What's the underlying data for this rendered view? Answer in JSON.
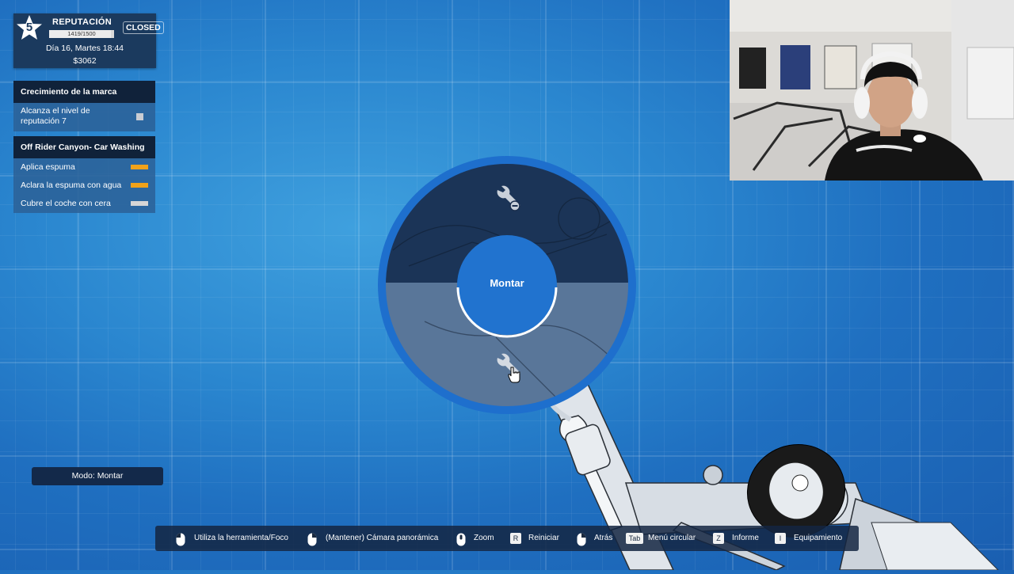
{
  "hud": {
    "level": "5",
    "reputation_title": "REPUTACIÓN",
    "reputation_progress": "1419/1500",
    "reputation_fraction": 0.946,
    "shop_status": "CLOSED",
    "datetime": "Día 16, Martes 18:44",
    "money": "$3062"
  },
  "objectives": {
    "brand": {
      "title": "Crecimiento de la marca",
      "items": [
        {
          "label": "Alcanza el nivel de reputación 7",
          "status": "pending"
        }
      ]
    },
    "job": {
      "title": "Off Rider Canyon- Car Washing",
      "items": [
        {
          "label": "Aplica espuma",
          "color": "#f0a21a"
        },
        {
          "label": "Aclara la espuma con agua",
          "color": "#f0a21a"
        },
        {
          "label": "Cubre el coche con cera",
          "color": "#d6d6d6"
        }
      ]
    }
  },
  "mode": {
    "label": "Modo: Montar"
  },
  "radial_menu": {
    "center_label": "Montar",
    "top_option_icon": "wrench-minus-icon",
    "bottom_option_icon": "wrench-icon",
    "active_option": "bottom"
  },
  "controls": [
    {
      "input": "mouse-left-icon",
      "label": "Utiliza la herramienta/Foco"
    },
    {
      "input": "mouse-right-icon",
      "label": "(Mantener)  Cámara panorámica"
    },
    {
      "input": "mouse-wheel-icon",
      "label": "Zoom"
    },
    {
      "input": "R",
      "label": "Reiniciar"
    },
    {
      "input": "mouse-right-icon",
      "label": "Atrás"
    },
    {
      "input": "Tab",
      "label": "Menú circular"
    },
    {
      "input": "Z",
      "label": "Informe"
    },
    {
      "input": "I",
      "label": "Equipamiento"
    }
  ]
}
